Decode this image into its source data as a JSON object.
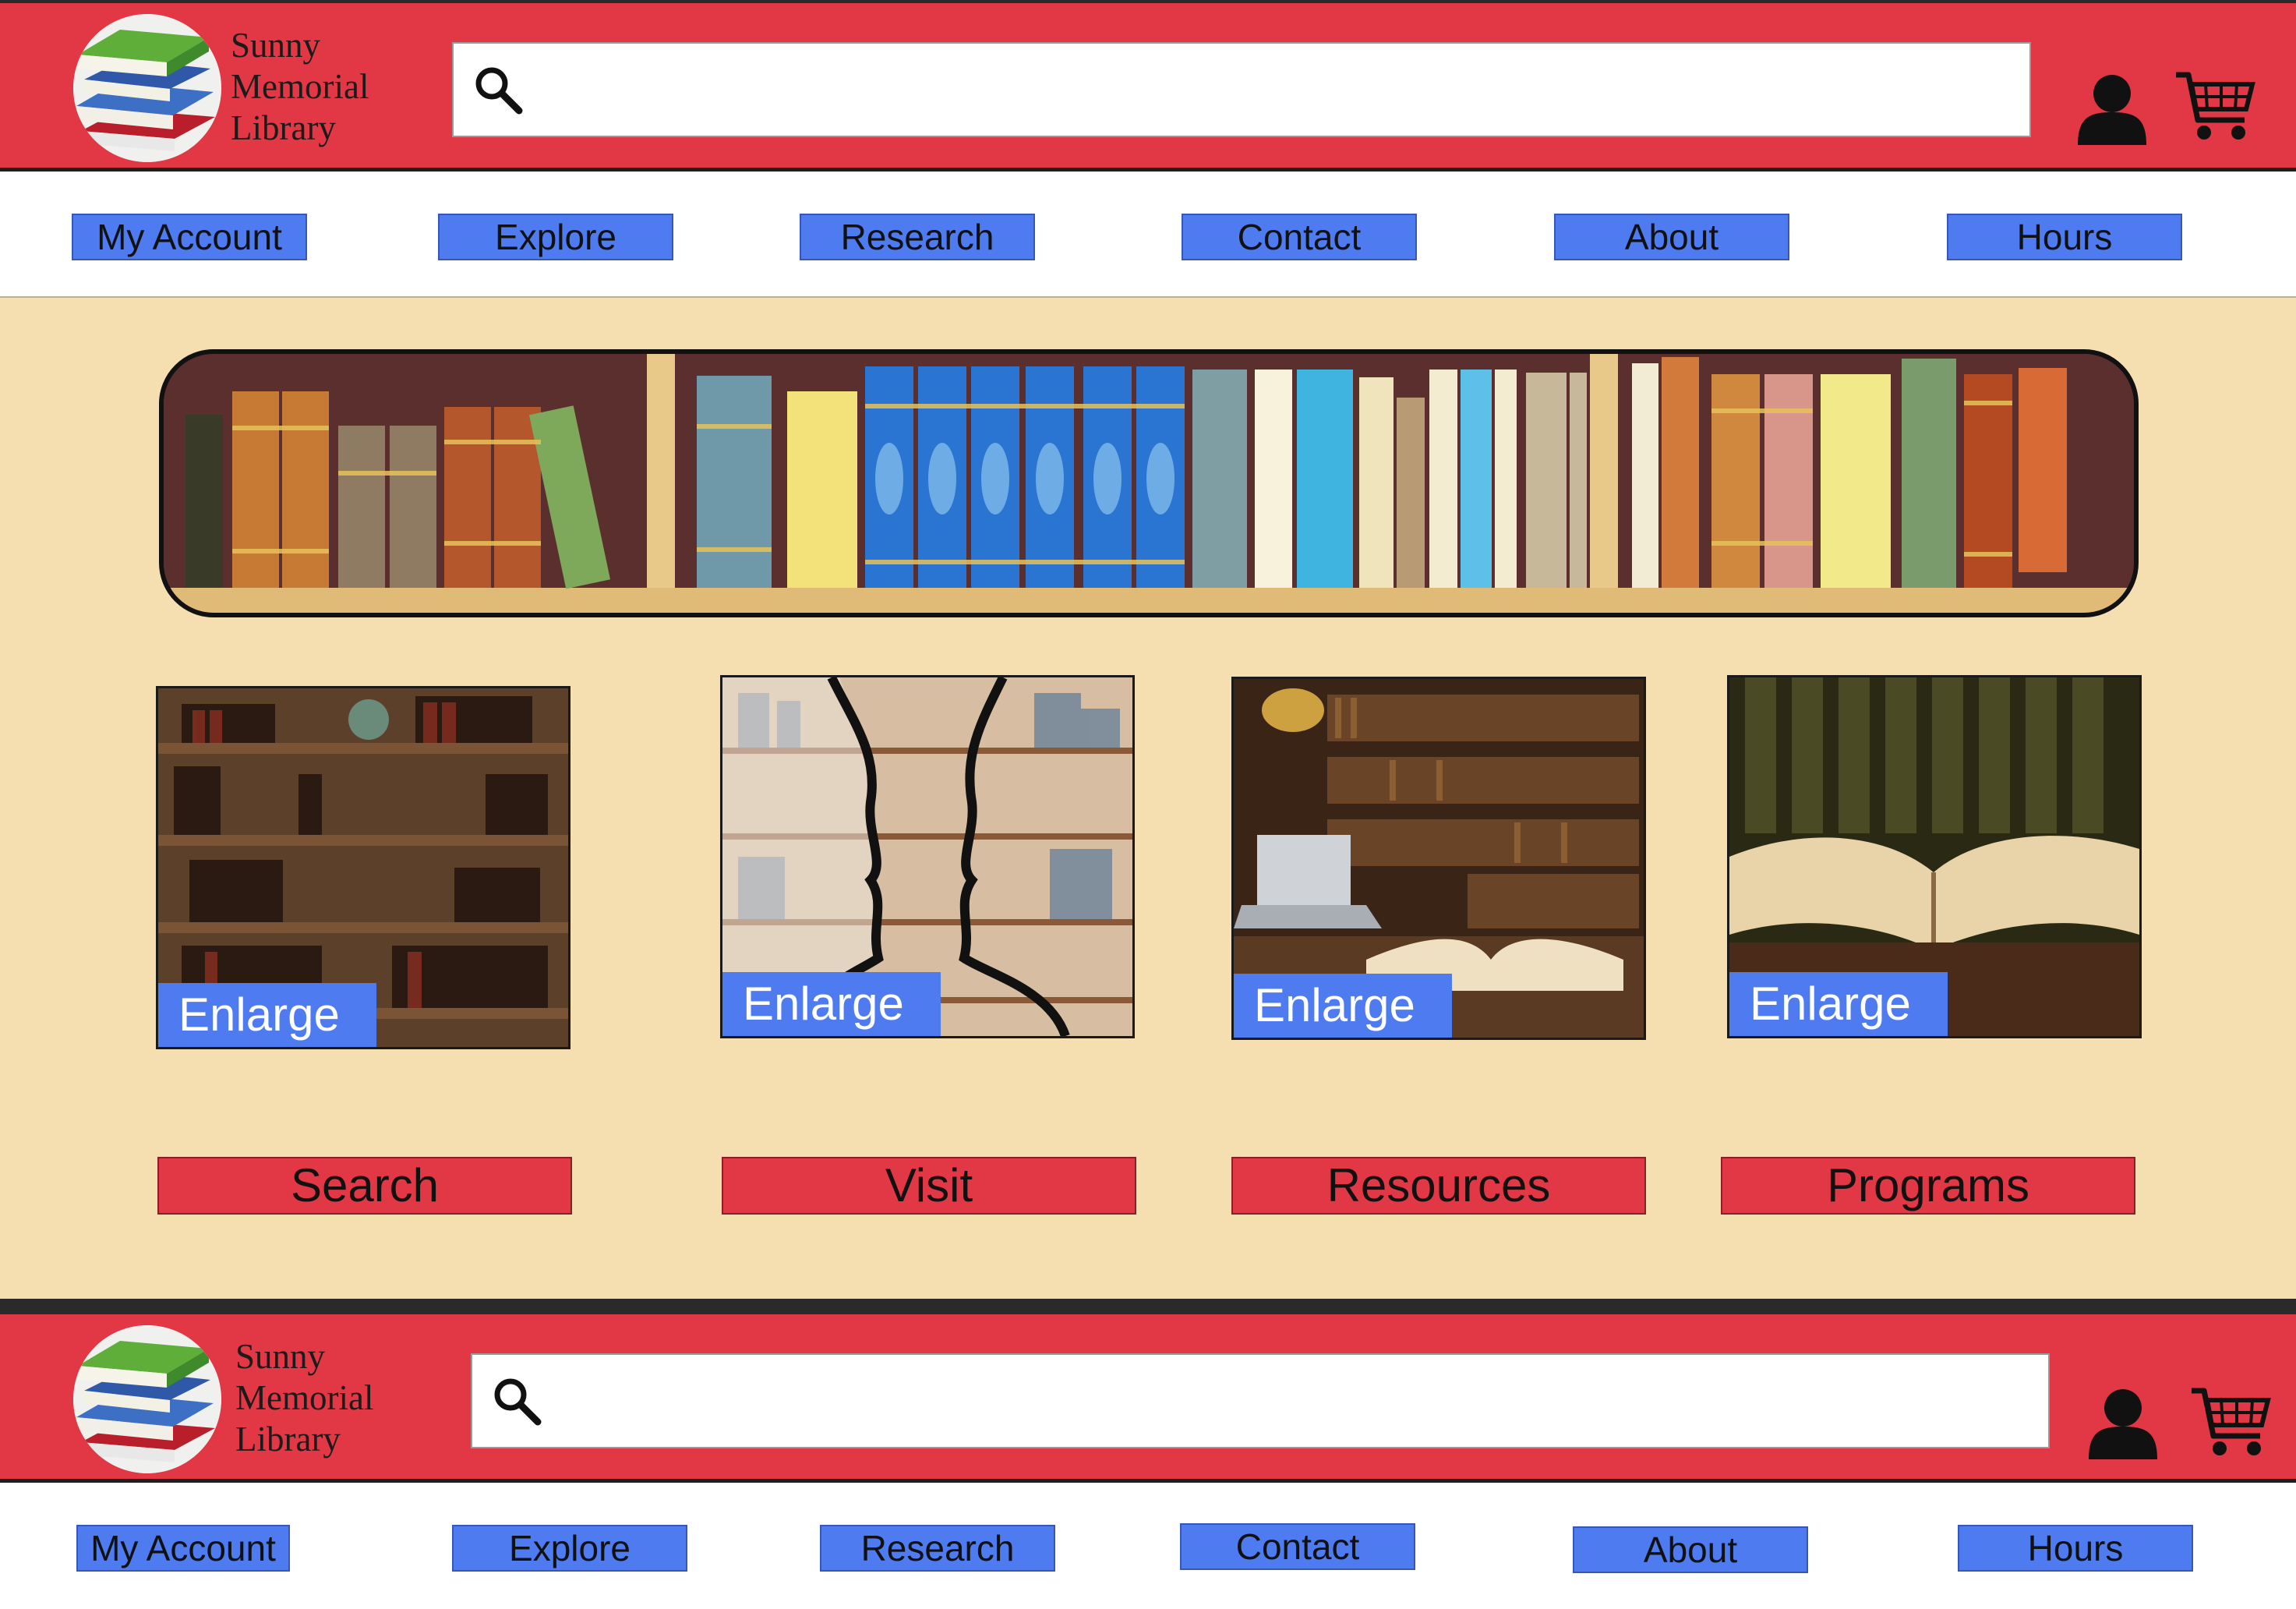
{
  "brand": {
    "line1": "Sunny",
    "line2": "Memorial",
    "line3": "Library"
  },
  "search": {
    "value": "",
    "placeholder": ""
  },
  "icons": {
    "search": "search-icon",
    "account": "user-icon",
    "cart": "cart-icon",
    "logo": "book-stack-icon"
  },
  "nav": {
    "my_account": "My Account",
    "explore": "Explore",
    "research": "Research",
    "contact": "Contact",
    "about": "About",
    "hours": "Hours"
  },
  "tiles": {
    "enlarge_label": "Enlarge",
    "categories": [
      "Search",
      "Visit",
      "Resources",
      "Programs"
    ]
  },
  "colors": {
    "header_red": "#e23744",
    "nav_blue": "#4f7bf0",
    "page_background": "#f5dfb0"
  }
}
